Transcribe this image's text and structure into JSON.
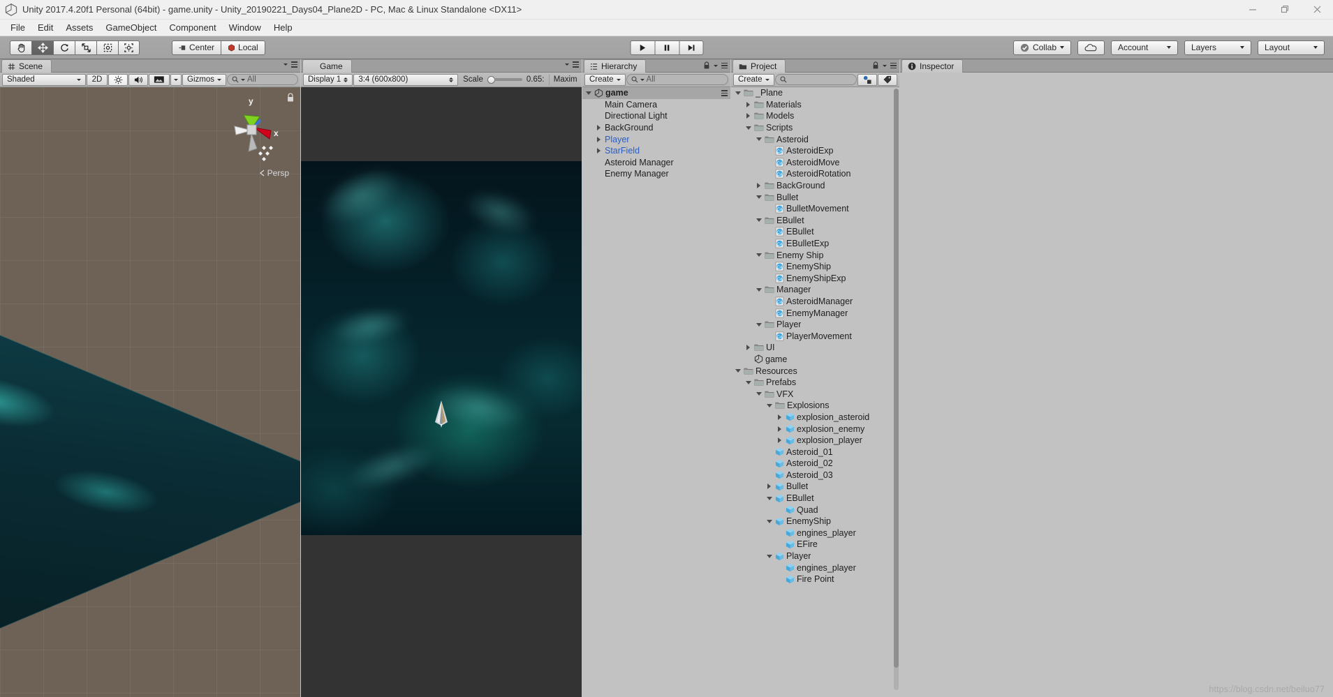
{
  "window": {
    "title": "Unity 2017.4.20f1 Personal (64bit) - game.unity - Unity_20190221_Days04_Plane2D - PC, Mac & Linux Standalone <DX11>",
    "minimize": "minimize-icon",
    "restore": "restore-icon",
    "close": "close-icon"
  },
  "menubar": {
    "items": [
      {
        "label": "File"
      },
      {
        "label": "Edit"
      },
      {
        "label": "Assets"
      },
      {
        "label": "GameObject"
      },
      {
        "label": "Component"
      },
      {
        "label": "Window"
      },
      {
        "label": "Help"
      }
    ]
  },
  "toolbar": {
    "tools": [
      {
        "name": "hand-tool",
        "active": false
      },
      {
        "name": "move-tool",
        "active": true
      },
      {
        "name": "rotate-tool",
        "active": false
      },
      {
        "name": "scale-tool",
        "active": false
      },
      {
        "name": "rect-tool",
        "active": false
      },
      {
        "name": "transform-tool",
        "active": false
      }
    ],
    "pivot_label": "Center",
    "space_label": "Local",
    "play_label": "play-icon",
    "pause_label": "pause-icon",
    "step_label": "step-icon",
    "collab_label": "Collab",
    "cloud_label": "cloud-icon",
    "account_label": "Account",
    "layers_label": "Layers",
    "layout_label": "Layout"
  },
  "scene": {
    "tab_label": "Scene",
    "shading_mode": "Shaded",
    "mode_2d": "2D",
    "lighting": "lighting-icon",
    "audio": "audio-icon",
    "fx": "fx-icon",
    "gizmos_label": "Gizmos",
    "search_placeholder": "All",
    "gizmo_axis_y": "y",
    "gizmo_axis_x": "x",
    "perspective_label": "Persp"
  },
  "game": {
    "tab_label": "Game",
    "display_label": "Display 1",
    "aspect_label": "3:4 (600x800)",
    "scale_label": "Scale",
    "scale_value": "0.65:",
    "maximize_label": "Maxim"
  },
  "hierarchy": {
    "tab_label": "Hierarchy",
    "create_label": "Create",
    "search_placeholder": "All",
    "items": [
      {
        "label": "game",
        "depth": 0,
        "twirl": "down",
        "icon": "unity-scene-icon",
        "bold": true,
        "selected": true,
        "color": "normal"
      },
      {
        "label": "Main Camera",
        "depth": 1,
        "twirl": "none",
        "icon": "none",
        "bold": false,
        "selected": false,
        "color": "normal"
      },
      {
        "label": "Directional Light",
        "depth": 1,
        "twirl": "none",
        "icon": "none",
        "bold": false,
        "selected": false,
        "color": "normal"
      },
      {
        "label": "BackGround",
        "depth": 1,
        "twirl": "right",
        "icon": "none",
        "bold": false,
        "selected": false,
        "color": "normal"
      },
      {
        "label": "Player",
        "depth": 1,
        "twirl": "right",
        "icon": "none",
        "bold": false,
        "selected": false,
        "color": "blue"
      },
      {
        "label": "StarField",
        "depth": 1,
        "twirl": "right",
        "icon": "none",
        "bold": false,
        "selected": false,
        "color": "blue"
      },
      {
        "label": "Asteroid Manager",
        "depth": 1,
        "twirl": "none",
        "icon": "none",
        "bold": false,
        "selected": false,
        "color": "normal"
      },
      {
        "label": "Enemy Manager",
        "depth": 1,
        "twirl": "none",
        "icon": "none",
        "bold": false,
        "selected": false,
        "color": "normal"
      }
    ]
  },
  "project": {
    "tab_label": "Project",
    "create_label": "Create",
    "search_placeholder": "",
    "filter_type_icon": "filter-type-icon",
    "filter_label_icon": "filter-label-icon",
    "items": [
      {
        "label": "_Plane",
        "depth": 0,
        "twirl": "down",
        "icon": "folder"
      },
      {
        "label": "Materials",
        "depth": 1,
        "twirl": "right",
        "icon": "folder"
      },
      {
        "label": "Models",
        "depth": 1,
        "twirl": "right",
        "icon": "folder"
      },
      {
        "label": "Scripts",
        "depth": 1,
        "twirl": "down",
        "icon": "folder"
      },
      {
        "label": "Asteroid",
        "depth": 2,
        "twirl": "down",
        "icon": "folder"
      },
      {
        "label": "AsteroidExp",
        "depth": 3,
        "twirl": "none",
        "icon": "script"
      },
      {
        "label": "AsteroidMove",
        "depth": 3,
        "twirl": "none",
        "icon": "script"
      },
      {
        "label": "AsteroidRotation",
        "depth": 3,
        "twirl": "none",
        "icon": "script"
      },
      {
        "label": "BackGround",
        "depth": 2,
        "twirl": "right",
        "icon": "folder"
      },
      {
        "label": "Bullet",
        "depth": 2,
        "twirl": "down",
        "icon": "folder"
      },
      {
        "label": "BulletMovement",
        "depth": 3,
        "twirl": "none",
        "icon": "script"
      },
      {
        "label": "EBullet",
        "depth": 2,
        "twirl": "down",
        "icon": "folder"
      },
      {
        "label": "EBullet",
        "depth": 3,
        "twirl": "none",
        "icon": "script"
      },
      {
        "label": "EBulletExp",
        "depth": 3,
        "twirl": "none",
        "icon": "script"
      },
      {
        "label": "Enemy Ship",
        "depth": 2,
        "twirl": "down",
        "icon": "folder"
      },
      {
        "label": "EnemyShip",
        "depth": 3,
        "twirl": "none",
        "icon": "script"
      },
      {
        "label": "EnemyShipExp",
        "depth": 3,
        "twirl": "none",
        "icon": "script"
      },
      {
        "label": "Manager",
        "depth": 2,
        "twirl": "down",
        "icon": "folder"
      },
      {
        "label": "AsteroidManager",
        "depth": 3,
        "twirl": "none",
        "icon": "script"
      },
      {
        "label": "EnemyManager",
        "depth": 3,
        "twirl": "none",
        "icon": "script"
      },
      {
        "label": "Player",
        "depth": 2,
        "twirl": "down",
        "icon": "folder"
      },
      {
        "label": "PlayerMovement",
        "depth": 3,
        "twirl": "none",
        "icon": "script"
      },
      {
        "label": "UI",
        "depth": 1,
        "twirl": "right",
        "icon": "folder"
      },
      {
        "label": "game",
        "depth": 1,
        "twirl": "none",
        "icon": "unity-scene-icon"
      },
      {
        "label": "Resources",
        "depth": 0,
        "twirl": "down",
        "icon": "folder"
      },
      {
        "label": "Prefabs",
        "depth": 1,
        "twirl": "down",
        "icon": "folder"
      },
      {
        "label": "VFX",
        "depth": 2,
        "twirl": "down",
        "icon": "folder"
      },
      {
        "label": "Explosions",
        "depth": 3,
        "twirl": "down",
        "icon": "folder"
      },
      {
        "label": "explosion_asteroid",
        "depth": 4,
        "twirl": "right",
        "icon": "prefab"
      },
      {
        "label": "explosion_enemy",
        "depth": 4,
        "twirl": "right",
        "icon": "prefab"
      },
      {
        "label": "explosion_player",
        "depth": 4,
        "twirl": "right",
        "icon": "prefab"
      },
      {
        "label": "Asteroid_01",
        "depth": 3,
        "twirl": "none",
        "icon": "prefab"
      },
      {
        "label": "Asteroid_02",
        "depth": 3,
        "twirl": "none",
        "icon": "prefab"
      },
      {
        "label": "Asteroid_03",
        "depth": 3,
        "twirl": "none",
        "icon": "prefab"
      },
      {
        "label": "Bullet",
        "depth": 3,
        "twirl": "right",
        "icon": "prefab"
      },
      {
        "label": "EBullet",
        "depth": 3,
        "twirl": "down",
        "icon": "prefab"
      },
      {
        "label": "Quad",
        "depth": 4,
        "twirl": "none",
        "icon": "prefab"
      },
      {
        "label": "EnemyShip",
        "depth": 3,
        "twirl": "down",
        "icon": "prefab"
      },
      {
        "label": "engines_player",
        "depth": 4,
        "twirl": "none",
        "icon": "prefab"
      },
      {
        "label": "EFire",
        "depth": 4,
        "twirl": "none",
        "icon": "prefab"
      },
      {
        "label": "Player",
        "depth": 3,
        "twirl": "down",
        "icon": "prefab"
      },
      {
        "label": "engines_player",
        "depth": 4,
        "twirl": "none",
        "icon": "prefab"
      },
      {
        "label": "Fire Point",
        "depth": 4,
        "twirl": "none",
        "icon": "prefab"
      }
    ]
  },
  "inspector": {
    "tab_label": "Inspector"
  },
  "watermark": "https://blog.csdn.net/beiluo77",
  "colors": {
    "toolbar_bg": "#a5a5a5",
    "panel_bg": "#c2c2c2",
    "tab_bg": "#cccccc",
    "prefab_blue": "#2b5dc4",
    "scene_bg": "#6e6257"
  }
}
